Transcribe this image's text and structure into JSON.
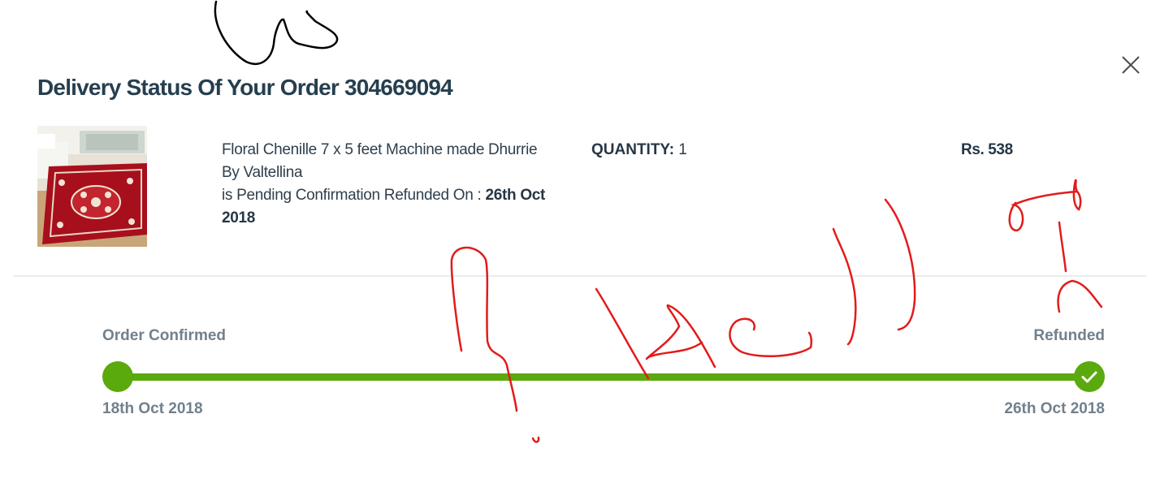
{
  "dialog": {
    "title": "Delivery Status Of Your Order 304669094",
    "close_icon": "close-icon"
  },
  "product": {
    "image_icon": "rug-product-image",
    "name_line1": "Floral Chenille 7 x 5 feet Machine made Dhurrie",
    "name_line2": "By Valtellina",
    "status_text": "is Pending Confirmation Refunded On : ",
    "refund_date_line1": "26th Oct",
    "refund_date_line2": "2018",
    "quantity_label": "QUANTITY:",
    "quantity_value": " 1",
    "price": "Rs. 538"
  },
  "timeline": {
    "start_label": "Order Confirmed",
    "start_date": "18th Oct 2018",
    "end_label": "Refunded",
    "end_date": "26th Oct 2018",
    "progress": 1.0,
    "end_icon": "checkmark-icon"
  },
  "colors": {
    "progress_green": "#5aa90d",
    "title_text": "#263f4f",
    "muted_text": "#71808c",
    "annotation_red": "#e21b1b",
    "annotation_black": "#000000"
  }
}
